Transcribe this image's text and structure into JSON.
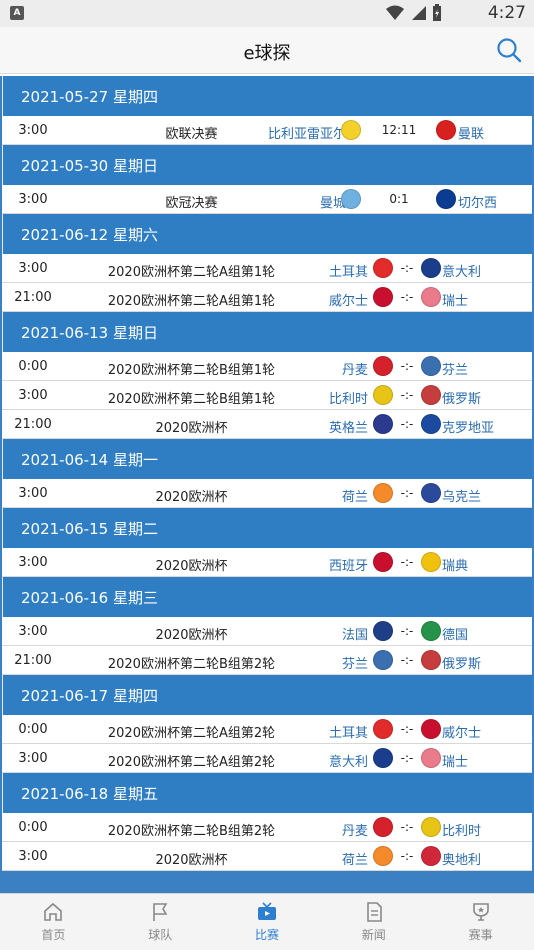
{
  "status": {
    "time": "4:27",
    "left_badge": "A"
  },
  "app": {
    "title": "e球探"
  },
  "days": [
    {
      "header": "2021-05-27 星期四",
      "layout": "wide",
      "matches": [
        {
          "time": "3:00",
          "league": "欧联决赛",
          "home": "比利亚雷亚尔",
          "score": "12:11",
          "away": "曼联",
          "home_color": "#f3d12a",
          "away_color": "#d8201f"
        }
      ]
    },
    {
      "header": "2021-05-30 星期日",
      "layout": "wide",
      "matches": [
        {
          "time": "3:00",
          "league": "欧冠决赛",
          "home": "曼城",
          "score": "0:1",
          "away": "切尔西",
          "home_color": "#6eb1e1",
          "away_color": "#0a3d91"
        }
      ]
    },
    {
      "header": "2021-06-12 星期六",
      "layout": "normal",
      "matches": [
        {
          "time": "3:00",
          "league": "2020欧洲杯第二轮A组第1轮",
          "home": "土耳其",
          "score": "-:-",
          "away": "意大利",
          "home_color": "#e22b2b",
          "away_color": "#1a3e8c"
        },
        {
          "time": "21:00",
          "league": "2020欧洲杯第二轮A组第1轮",
          "home": "威尔士",
          "score": "-:-",
          "away": "瑞士",
          "home_color": "#c8102e",
          "away_color": "#e97b8b"
        }
      ]
    },
    {
      "header": "2021-06-13 星期日",
      "layout": "normal",
      "matches": [
        {
          "time": "0:00",
          "league": "2020欧洲杯第二轮B组第1轮",
          "home": "丹麦",
          "score": "-:-",
          "away": "芬兰",
          "home_color": "#d4212b",
          "away_color": "#3a6fb0"
        },
        {
          "time": "3:00",
          "league": "2020欧洲杯第二轮B组第1轮",
          "home": "比利时",
          "score": "-:-",
          "away": "俄罗斯",
          "home_color": "#e7c416",
          "away_color": "#c53d3d"
        },
        {
          "time": "21:00",
          "league": "2020欧洲杯",
          "home": "英格兰",
          "score": "-:-",
          "away": "克罗地亚",
          "home_color": "#2b3a8f",
          "away_color": "#1b4aa0"
        }
      ]
    },
    {
      "header": "2021-06-14 星期一",
      "layout": "normal",
      "matches": [
        {
          "time": "3:00",
          "league": "2020欧洲杯",
          "home": "荷兰",
          "score": "-:-",
          "away": "乌克兰",
          "home_color": "#f58a2b",
          "away_color": "#2b4a9b"
        }
      ]
    },
    {
      "header": "2021-06-15 星期二",
      "layout": "normal",
      "matches": [
        {
          "time": "3:00",
          "league": "2020欧洲杯",
          "home": "西班牙",
          "score": "-:-",
          "away": "瑞典",
          "home_color": "#c8102e",
          "away_color": "#f0c20e"
        }
      ]
    },
    {
      "header": "2021-06-16 星期三",
      "layout": "normal",
      "matches": [
        {
          "time": "3:00",
          "league": "2020欧洲杯",
          "home": "法国",
          "score": "-:-",
          "away": "德国",
          "home_color": "#1f3e88",
          "away_color": "#27924a"
        },
        {
          "time": "21:00",
          "league": "2020欧洲杯第二轮B组第2轮",
          "home": "芬兰",
          "score": "-:-",
          "away": "俄罗斯",
          "home_color": "#3a6fb0",
          "away_color": "#c53d3d"
        }
      ]
    },
    {
      "header": "2021-06-17 星期四",
      "layout": "normal",
      "matches": [
        {
          "time": "0:00",
          "league": "2020欧洲杯第二轮A组第2轮",
          "home": "土耳其",
          "score": "-:-",
          "away": "威尔士",
          "home_color": "#e22b2b",
          "away_color": "#c8102e"
        },
        {
          "time": "3:00",
          "league": "2020欧洲杯第二轮A组第2轮",
          "home": "意大利",
          "score": "-:-",
          "away": "瑞士",
          "home_color": "#1a3e8c",
          "away_color": "#e97b8b"
        }
      ]
    },
    {
      "header": "2021-06-18 星期五",
      "layout": "normal",
      "matches": [
        {
          "time": "0:00",
          "league": "2020欧洲杯第二轮B组第2轮",
          "home": "丹麦",
          "score": "-:-",
          "away": "比利时",
          "home_color": "#d4212b",
          "away_color": "#e7c416"
        },
        {
          "time": "3:00",
          "league": "2020欧洲杯",
          "home": "荷兰",
          "score": "-:-",
          "away": "奥地利",
          "home_color": "#f58a2b",
          "away_color": "#d0283a"
        }
      ]
    }
  ],
  "nav": [
    {
      "label": "首页",
      "icon": "home-icon",
      "active": false
    },
    {
      "label": "球队",
      "icon": "flag-icon",
      "active": false
    },
    {
      "label": "比赛",
      "icon": "tv-icon",
      "active": true
    },
    {
      "label": "新闻",
      "icon": "news-icon",
      "active": false
    },
    {
      "label": "赛事",
      "icon": "trophy-icon",
      "active": false
    }
  ],
  "colors": {
    "accent": "#2e7fd0",
    "header_bg": "#2f7ec3",
    "team_link": "#2c6db0"
  }
}
